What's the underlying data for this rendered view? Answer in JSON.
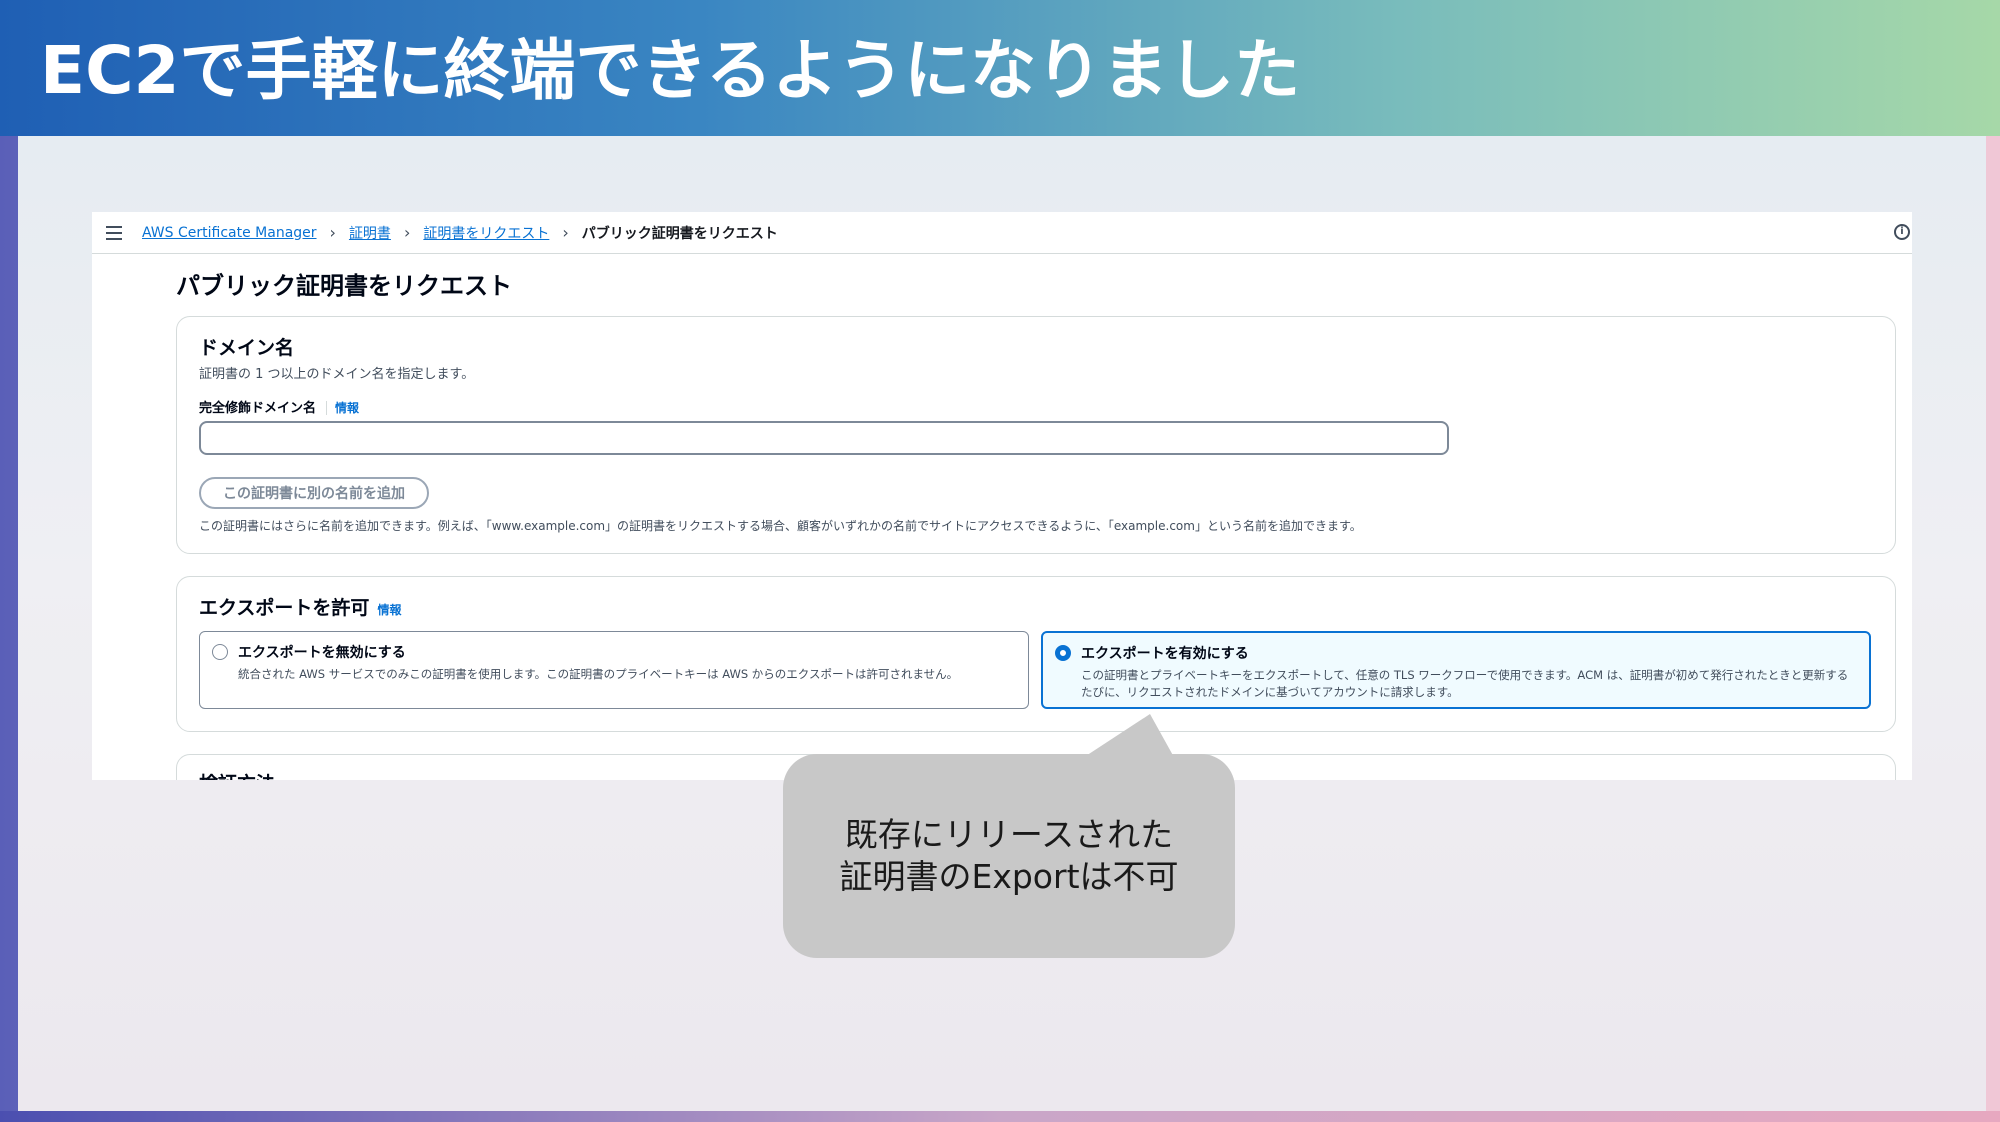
{
  "slide": {
    "title": "EC2で手軽に終端できるようになりました"
  },
  "console": {
    "breadcrumb": [
      {
        "label": "AWS Certificate Manager"
      },
      {
        "label": "証明書"
      },
      {
        "label": "証明書をリクエスト"
      },
      {
        "label": "パブリック証明書をリクエスト"
      }
    ],
    "breadcrumb_separator": "›",
    "page_title": "パブリック証明書をリクエスト",
    "domain_section": {
      "title": "ドメイン名",
      "description": "証明書の 1 つ以上のドメイン名を指定します。",
      "field_label": "完全修飾ドメイン名",
      "info_link": "情報",
      "input_value": "",
      "add_name_button": "この証明書に別の名前を追加",
      "hint": "この証明書にはさらに名前を追加できます。例えば、「www.example.com」の証明書をリクエストする場合、顧客がいずれかの名前でサイトにアクセスできるように、「example.com」という名前を追加できます。"
    },
    "export_section": {
      "title": "エクスポートを許可",
      "info_link": "情報",
      "options": [
        {
          "label": "エクスポートを無効にする",
          "description": "統合された AWS サービスでのみこの証明書を使用します。この証明書のプライベートキーは AWS からのエクスポートは許可されません。",
          "selected": false
        },
        {
          "label": "エクスポートを有効にする",
          "description": "この証明書とプライベートキーをエクスポートして、任意の TLS ワークフローで使用できます。ACM は、証明書が初めて発行されたときと更新するたびに、リクエストされたドメインに基づいてアカウントに請求します。",
          "selected": true
        }
      ]
    },
    "verify_section": {
      "title": "検証方法"
    }
  },
  "callout": {
    "line1": "既存にリリースされた",
    "line2": "証明書のExportは不可"
  }
}
